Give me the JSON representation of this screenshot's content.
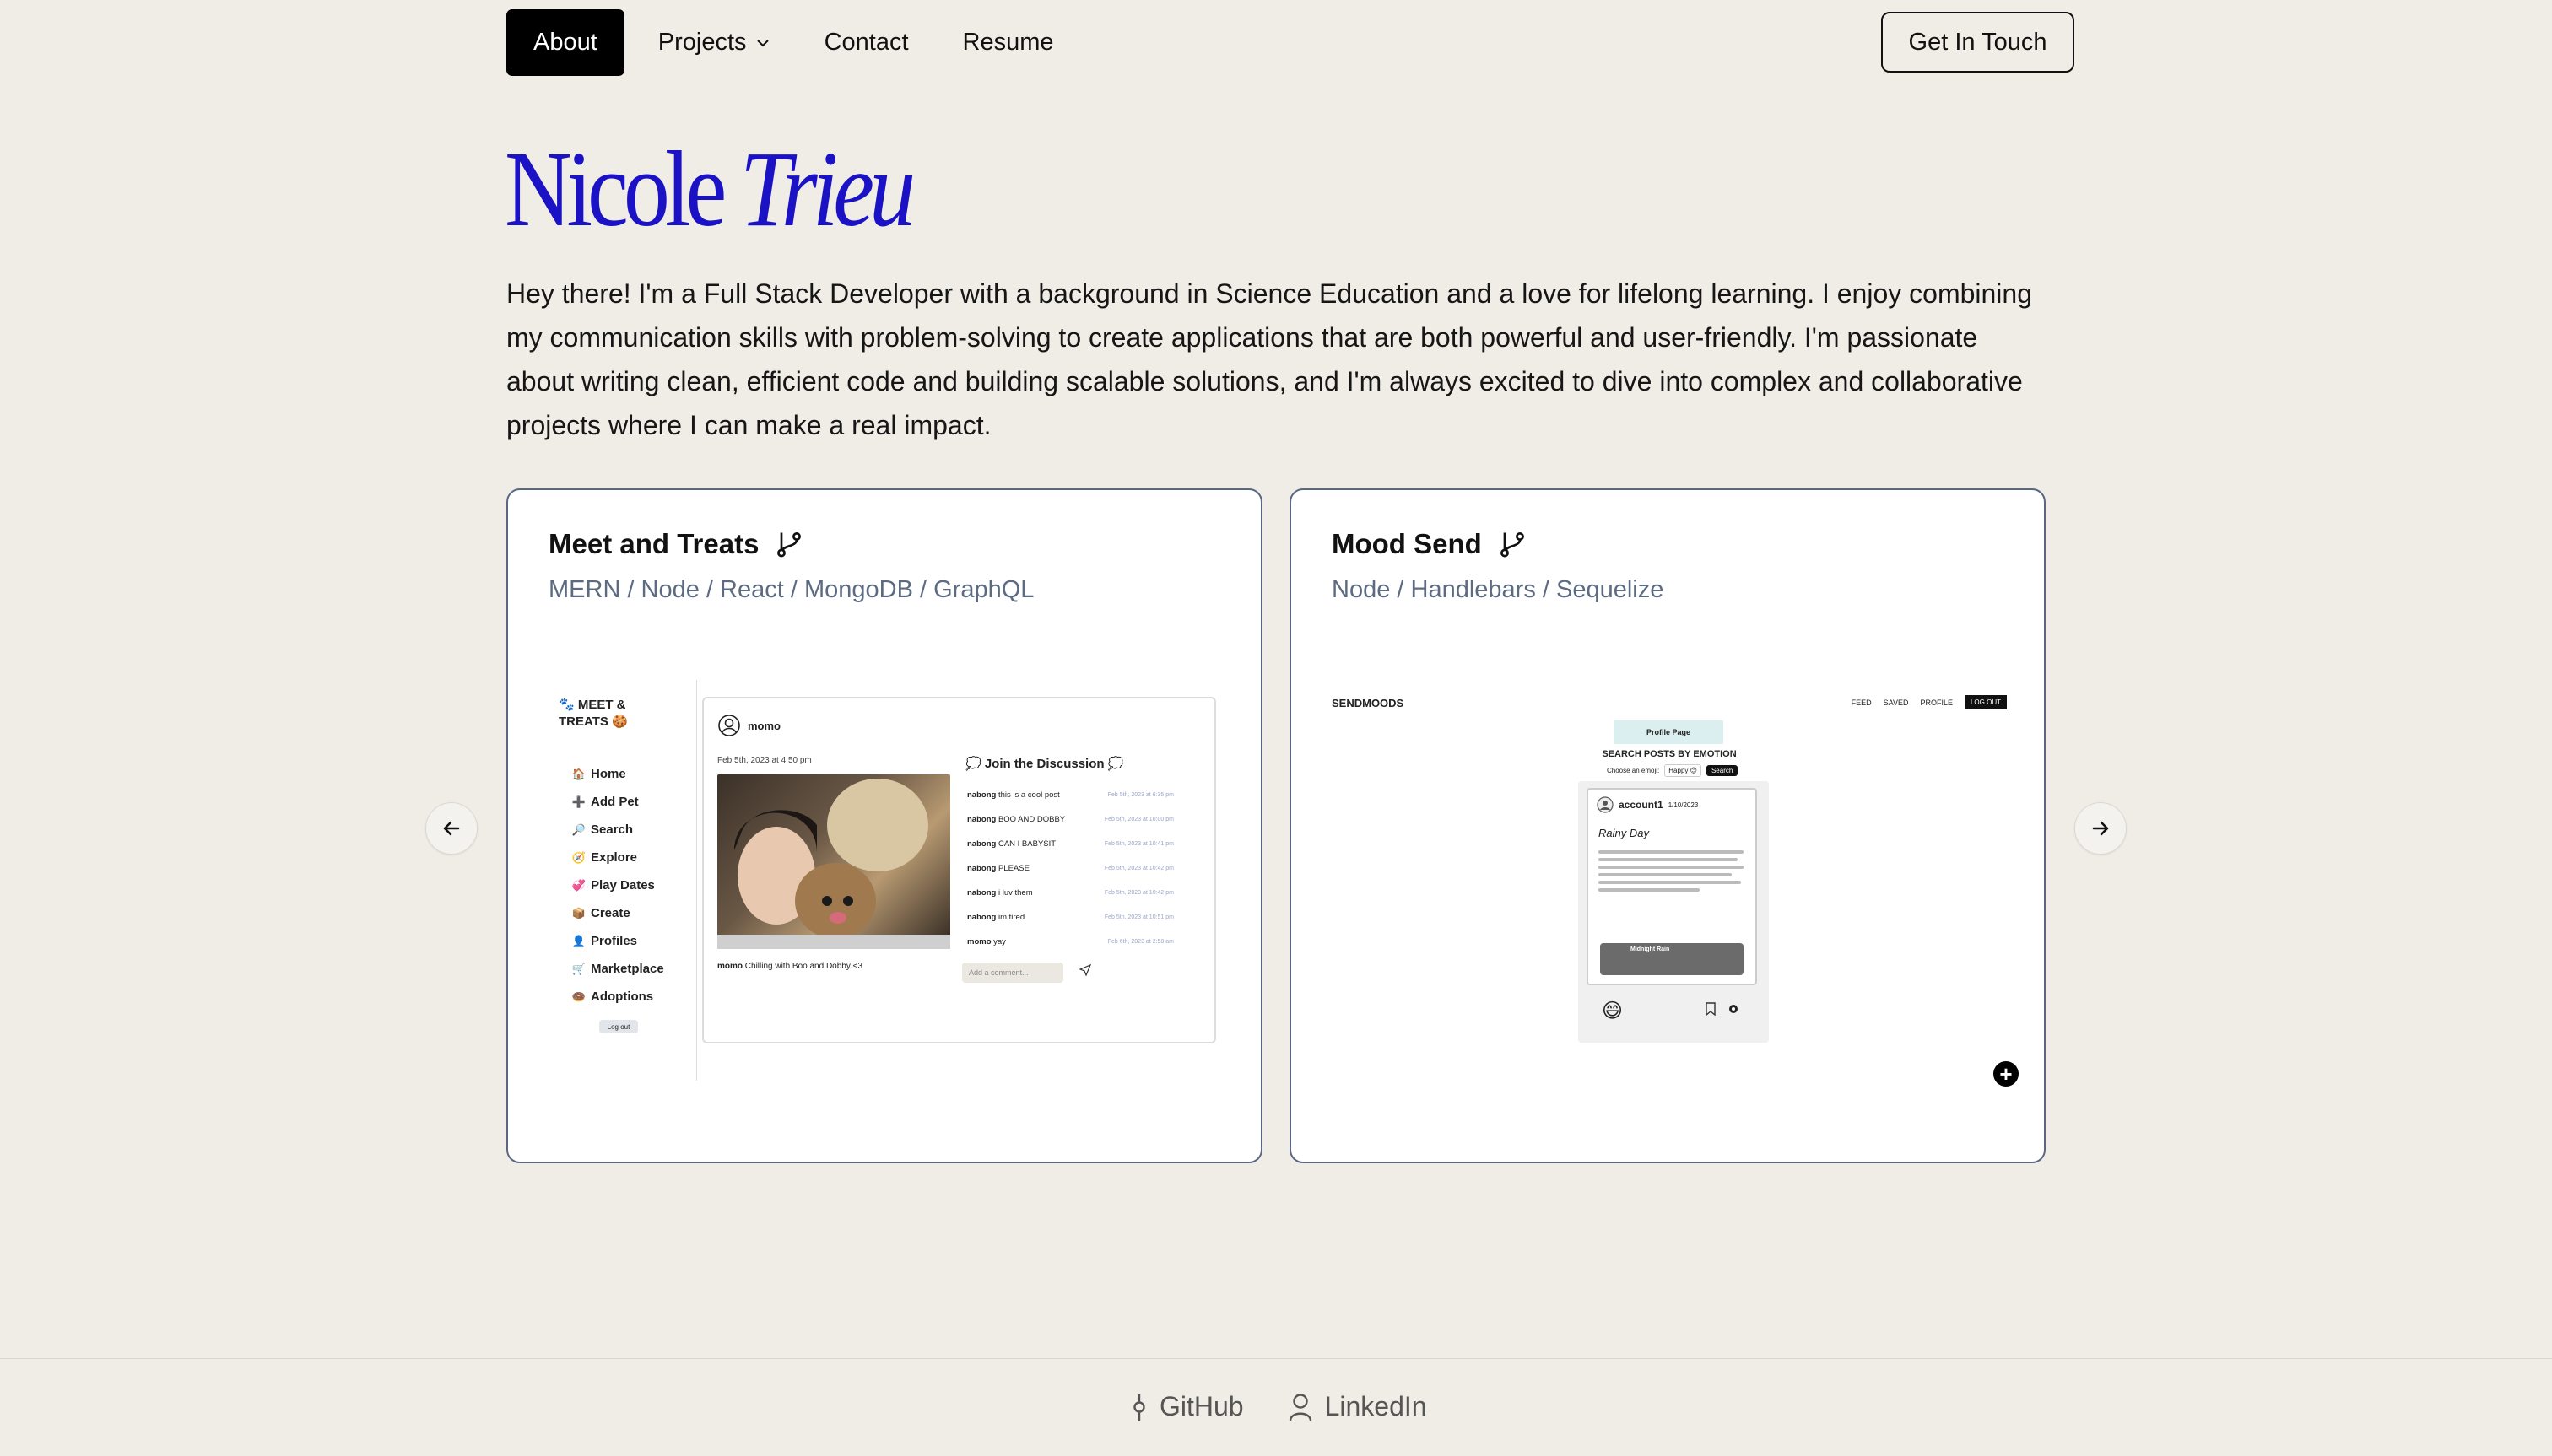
{
  "nav": {
    "items": [
      {
        "label": "About",
        "active": true
      },
      {
        "label": "Projects",
        "has_dropdown": true
      },
      {
        "label": "Contact"
      },
      {
        "label": "Resume"
      }
    ],
    "cta_label": "Get In Touch"
  },
  "hero": {
    "first_name": "Nicole",
    "last_name": "Trieu",
    "intro": "Hey there! I'm a Full Stack Developer with a background in Science Education and a love for lifelong learning. I enjoy combining my communication skills with problem-solving to create applications that are both powerful and user-friendly. I'm passionate about writing clean, efficient code and building scalable solutions, and I'm always excited to dive into complex and collaborative projects where I can make a real impact."
  },
  "projects": [
    {
      "title": "Meet and Treats",
      "tags": "MERN / Node / React / MongoDB / GraphQL",
      "screenshot": {
        "logo": "🐾 MEET & TREATS 🍪",
        "nav": [
          {
            "icon": "🏠",
            "label": "Home"
          },
          {
            "icon": "➕",
            "label": "Add Pet"
          },
          {
            "icon": "🔎",
            "label": "Search"
          },
          {
            "icon": "🧭",
            "label": "Explore"
          },
          {
            "icon": "💞",
            "label": "Play Dates"
          },
          {
            "icon": "📦",
            "label": "Create"
          },
          {
            "icon": "👤",
            "label": "Profiles"
          },
          {
            "icon": "🛒",
            "label": "Marketplace"
          },
          {
            "icon": "🍩",
            "label": "Adoptions"
          }
        ],
        "logout": "Log out",
        "post_user": "momo",
        "post_date": "Feb 5th, 2023 at 4:50 pm",
        "caption_user": "momo",
        "caption_text": "Chilling with Boo and Dobby <3",
        "discussion_title": "💭 Join the Discussion 💭",
        "comments": [
          {
            "user": "nabong",
            "text": "this is a cool post",
            "time": "Feb 5th, 2023 at 6:35 pm"
          },
          {
            "user": "nabong",
            "text": "BOO AND DOBBY",
            "time": "Feb 5th, 2023 at 10:00 pm"
          },
          {
            "user": "nabong",
            "text": "CAN I BABYSIT",
            "time": "Feb 5th, 2023 at 10:41 pm"
          },
          {
            "user": "nabong",
            "text": "PLEASE",
            "time": "Feb 5th, 2023 at 10:42 pm"
          },
          {
            "user": "nabong",
            "text": "i luv them",
            "time": "Feb 5th, 2023 at 10:42 pm"
          },
          {
            "user": "nabong",
            "text": "im tired",
            "time": "Feb 5th, 2023 at 10:51 pm"
          },
          {
            "user": "momo",
            "text": "yay",
            "time": "Feb 6th, 2023 at 2:58 am"
          }
        ],
        "comment_placeholder": "Add a comment..."
      }
    },
    {
      "title": "Mood Send",
      "tags": "Node / Handlebars / Sequelize",
      "screenshot": {
        "brand": "SENDMOODS",
        "menu": [
          "FEED",
          "SAVED",
          "PROFILE"
        ],
        "logout": "LOG OUT",
        "profile_page": "Profile Page",
        "search_title": "SEARCH POSTS BY EMOTION",
        "choose_label": "Choose an emoji:",
        "choose_value": "Happy 😊",
        "search_button": "Search",
        "account": "account1",
        "account_date": "1/10/2023",
        "post_title": "Rainy Day",
        "track_name": "Midnight Rain",
        "emoji": "😄"
      }
    }
  ],
  "footer": {
    "links": [
      {
        "label": "GitHub",
        "icon": "git-commit-icon"
      },
      {
        "label": "LinkedIn",
        "icon": "person-icon"
      }
    ]
  }
}
